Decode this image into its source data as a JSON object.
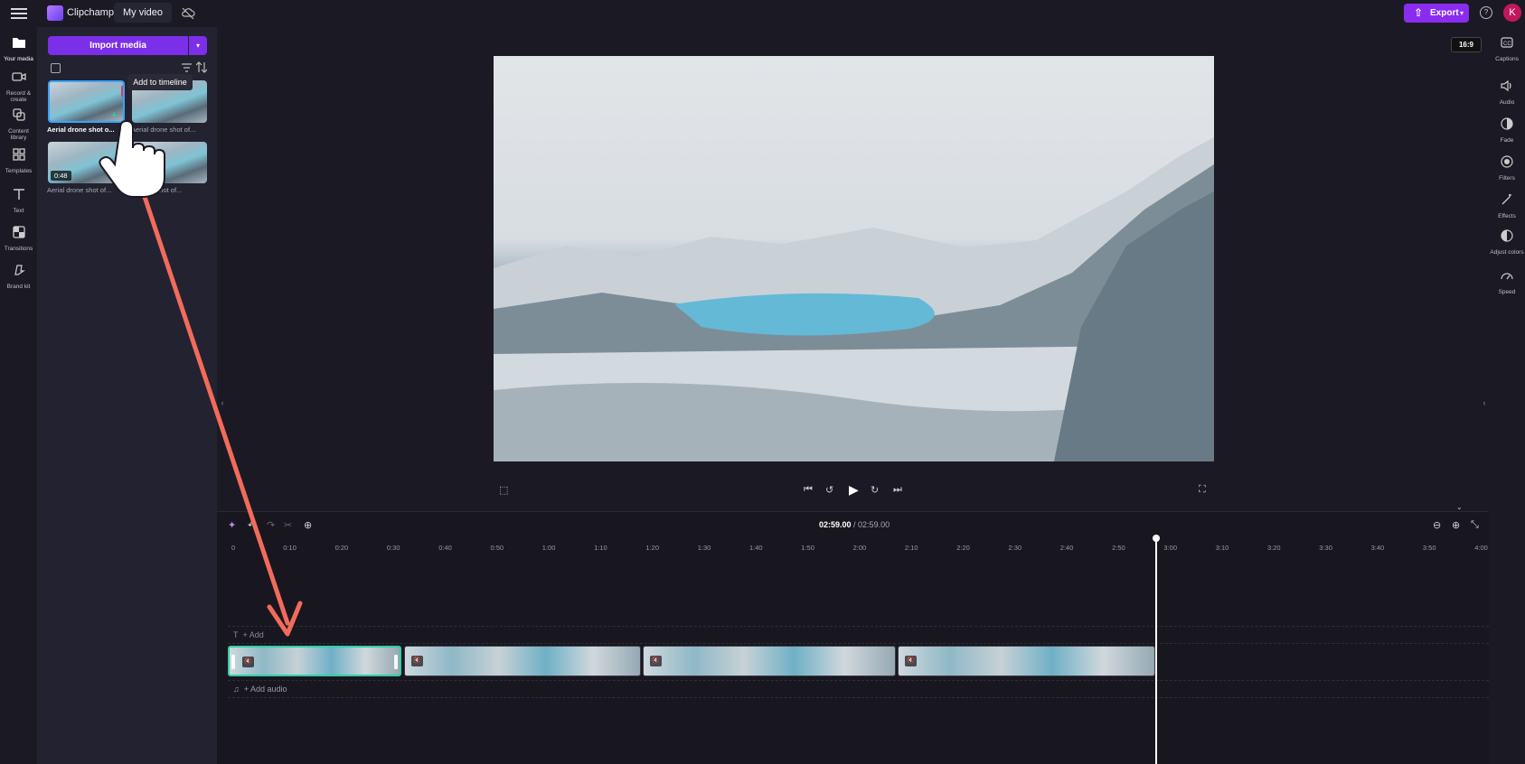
{
  "header": {
    "app_name": "Clipchamp",
    "project_title": "My video",
    "export_label": "Export",
    "avatar_initial": "K"
  },
  "left_rail": {
    "items": [
      {
        "label": "Your media",
        "icon": "folder-icon"
      },
      {
        "label": "Record & create",
        "icon": "camera-icon"
      },
      {
        "label": "Content library",
        "icon": "library-icon"
      },
      {
        "label": "Templates",
        "icon": "templates-icon"
      },
      {
        "label": "Text",
        "icon": "text-icon"
      },
      {
        "label": "Transitions",
        "icon": "transitions-icon"
      },
      {
        "label": "Brand kit",
        "icon": "brand-kit-icon"
      }
    ]
  },
  "media_panel": {
    "import_label": "Import media",
    "tooltip": "Add to timeline",
    "items": [
      {
        "caption": "Aerial drone shot o...",
        "duration": ""
      },
      {
        "caption": "Aerial drone shot of...",
        "duration": ""
      },
      {
        "caption": "Aerial drone shot of...",
        "duration": "0:48"
      },
      {
        "caption": "...drone shot of...",
        "duration": ""
      }
    ]
  },
  "preview": {
    "aspect_ratio": "16:9"
  },
  "right_rail": {
    "items": [
      {
        "label": "Captions",
        "icon": "captions-icon"
      },
      {
        "label": "Audio",
        "icon": "speaker-icon"
      },
      {
        "label": "Fade",
        "icon": "fade-icon"
      },
      {
        "label": "Filters",
        "icon": "filters-icon"
      },
      {
        "label": "Effects",
        "icon": "effects-icon"
      },
      {
        "label": "Adjust colors",
        "icon": "adjust-colors-icon"
      },
      {
        "label": "Speed",
        "icon": "speed-icon"
      }
    ]
  },
  "timeline": {
    "current_time": "02:59.00",
    "total_time": "/ 02:59.00",
    "ticks": [
      "0",
      "0:10",
      "0:20",
      "0:30",
      "0:40",
      "0:50",
      "1:00",
      "1:10",
      "1:20",
      "1:30",
      "1:40",
      "1:50",
      "2:00",
      "2:10",
      "2:20",
      "2:30",
      "2:40",
      "2:50",
      "3:00",
      "3:10",
      "3:20",
      "3:30",
      "3:40",
      "3:50",
      "4:00"
    ],
    "text_track_label": "+ Add",
    "audio_track_label": "+ Add audio"
  },
  "colors": {
    "accent_purple": "#8a2cf0",
    "selection_green": "#2ecfa6",
    "annotation_arrow": "#f26b5b"
  }
}
